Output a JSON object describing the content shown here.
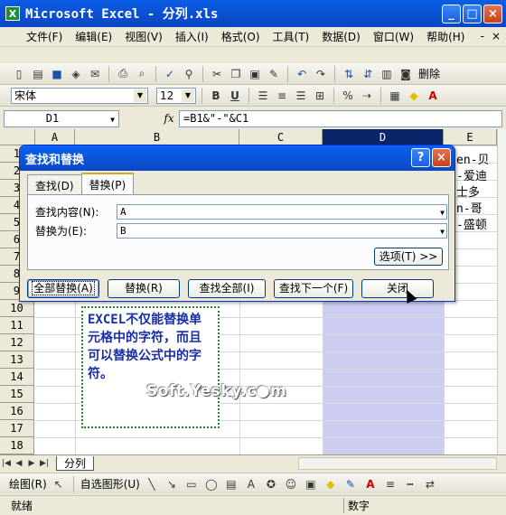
{
  "window": {
    "title": "Microsoft Excel - 分列.xls",
    "minimize": "_",
    "maximize": "□",
    "close": "×"
  },
  "menu": {
    "items": [
      "文件(F)",
      "编辑(E)",
      "视图(V)",
      "插入(I)",
      "格式(O)",
      "工具(T)",
      "数据(D)",
      "窗口(W)",
      "帮助(H)"
    ],
    "doc_minimize": "-",
    "doc_close": "×"
  },
  "toolbar": {
    "delete_label": "删除"
  },
  "format": {
    "font_name": "宋体",
    "font_size": "12",
    "bold": "B",
    "underline": "U",
    "percent": "%"
  },
  "formula_bar": {
    "name_box": "D1",
    "fx": "fx",
    "formula": "=B1&\"-\"&C1"
  },
  "grid": {
    "columns": [
      "A",
      "B",
      "C",
      "D",
      "E"
    ],
    "rows": [
      "1",
      "2",
      "3",
      "4",
      "5",
      "6",
      "7",
      "8",
      "9",
      "10",
      "11",
      "12",
      "13",
      "14",
      "15",
      "16",
      "17",
      "18"
    ],
    "selected_column": "D",
    "partial_cells": [
      "en-贝",
      "-爱迪",
      "士多",
      "n-哥",
      "-盛顿"
    ]
  },
  "note": {
    "text": "EXCEL不仅能替换单元格中的字符，而且可以替换公式中的字符。"
  },
  "watermark": "Soft.Yesky.c●m",
  "sheet": {
    "tab": "分列"
  },
  "drawing_toolbar": {
    "draw": "绘图(R)",
    "autoshapes": "自选图形(U)"
  },
  "status": {
    "left": "就绪",
    "mid": "数字"
  },
  "dialog": {
    "title": "查找和替换",
    "help": "?",
    "close": "×",
    "tabs": [
      "查找(D)",
      "替换(P)"
    ],
    "active_tab": "替换(P)",
    "find_label": "查找内容(N):",
    "find_value": "A",
    "replace_label": "替换为(E):",
    "replace_value": "B",
    "options_button": "选项(T) >>",
    "buttons": [
      "全部替换(A)",
      "替换(R)",
      "查找全部(I)",
      "查找下一个(F)",
      "关闭"
    ]
  }
}
